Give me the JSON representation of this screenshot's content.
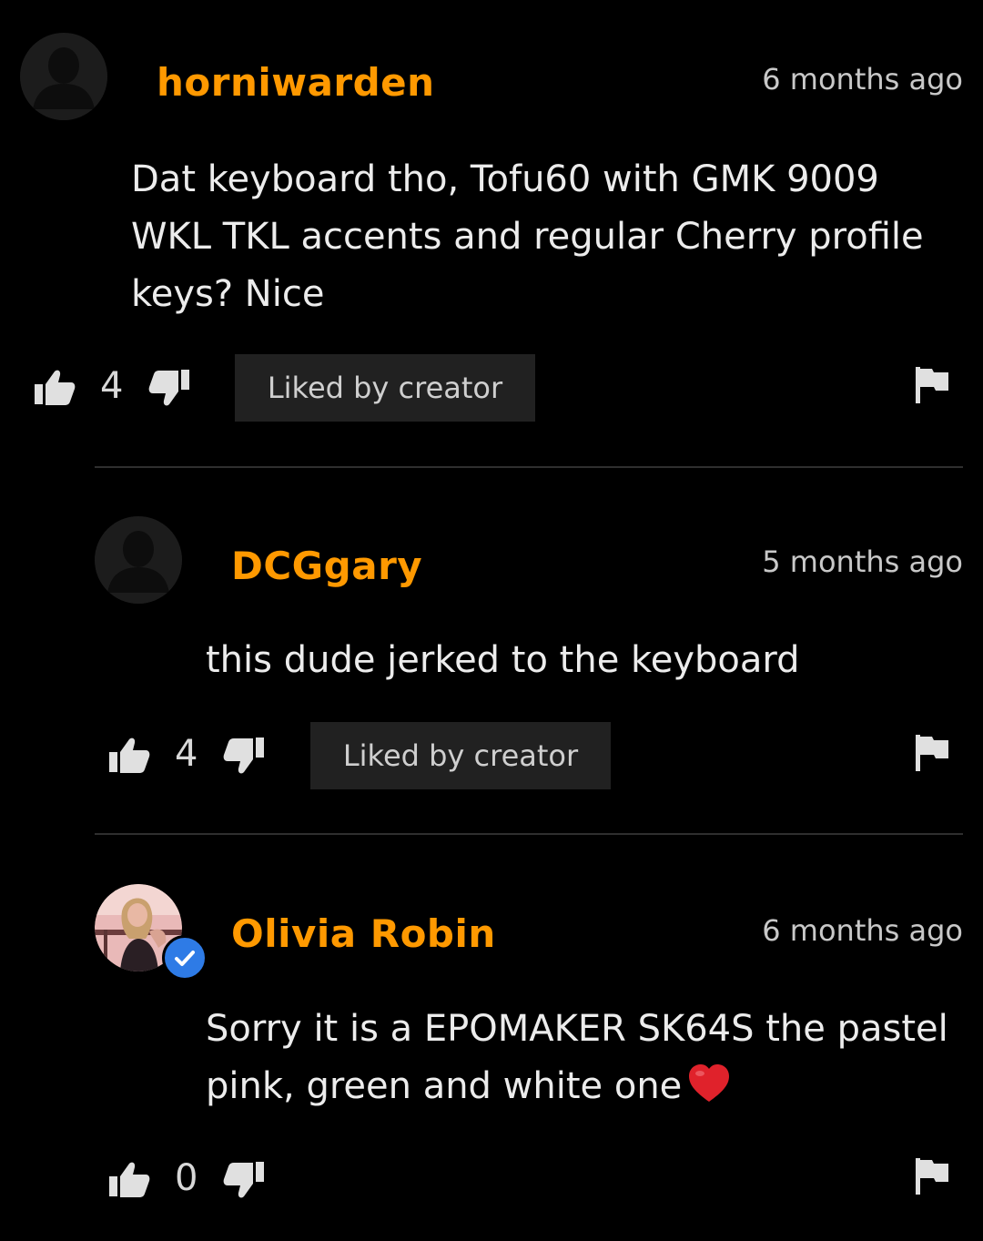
{
  "comments": [
    {
      "username": "horniwarden",
      "timestamp": "6 months ago",
      "text": "Dat keyboard tho, Tofu60 with GMK 9009 WKL TKL accents and regular Cherry profile keys? Nice",
      "likes": "4",
      "badge": "Liked by creator"
    },
    {
      "username": "DCGgary",
      "timestamp": "5 months ago",
      "text": "this dude jerked to the keyboard",
      "likes": "4",
      "badge": "Liked by creator"
    },
    {
      "username": "Olivia Robin",
      "timestamp": "6 months ago",
      "text": "Sorry it is a EPOMAKER SK64S the pastel pink, green and white one",
      "likes": "0",
      "verified": true
    }
  ],
  "colors": {
    "background": "#000000",
    "username": "#ff9900",
    "verified": "#2e7be6",
    "badge_bg": "#212121",
    "heart": "#e0222b"
  },
  "icons": {
    "like": "thumbs-up-icon",
    "dislike": "thumbs-down-icon",
    "report": "flag-icon",
    "verified": "checkmark-icon",
    "emoji": "heart-icon"
  }
}
